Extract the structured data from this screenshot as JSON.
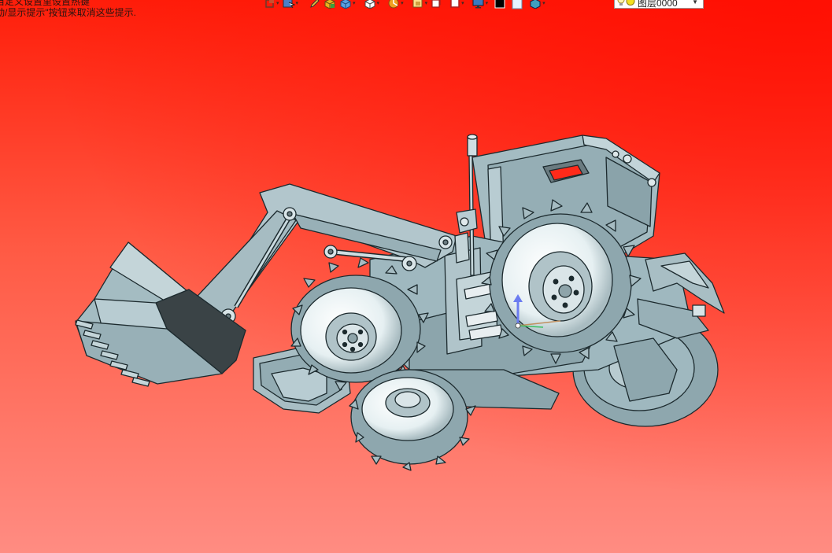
{
  "hints": {
    "line1": "自定义设置里设置热键",
    "line2": "动/显示提示\"按钮来取消这些提示."
  },
  "toolbar": {
    "items": [
      {
        "name": "snap-icon",
        "has_dropdown": true
      },
      {
        "name": "select-filter-icon",
        "has_dropdown": true
      },
      {
        "name": "sketch-pencil-icon",
        "has_dropdown": false
      },
      {
        "name": "solid-box-icon",
        "has_dropdown": false
      },
      {
        "name": "view-cube-icon",
        "has_dropdown": true
      },
      {
        "name": "render-mode-icon",
        "has_dropdown": true
      },
      {
        "name": "analysis-icon",
        "has_dropdown": true
      },
      {
        "name": "view-orient-icon",
        "has_dropdown": true
      },
      {
        "name": "section-view-icon",
        "has_dropdown": false
      },
      {
        "name": "clip-plane-icon",
        "has_dropdown": true
      },
      {
        "name": "monitor-display-icon",
        "has_dropdown": true
      },
      {
        "name": "color-black-swatch-icon",
        "has_dropdown": false
      },
      {
        "name": "color-white-swatch-icon",
        "has_dropdown": false
      },
      {
        "name": "material-icon",
        "has_dropdown": true
      }
    ],
    "layer_label": "图层0000"
  },
  "colors": {
    "bg_top": "#ff1e0a",
    "bg_bottom": "#ff8c82",
    "model_face": "#9fb8bf",
    "model_edge": "#1c2a2e",
    "model_dark": "#3a4346"
  },
  "viewport": {
    "model": "front-loader-tractor-3d-model",
    "triad_axes": [
      "x-axis",
      "y-axis",
      "z-axis"
    ]
  }
}
